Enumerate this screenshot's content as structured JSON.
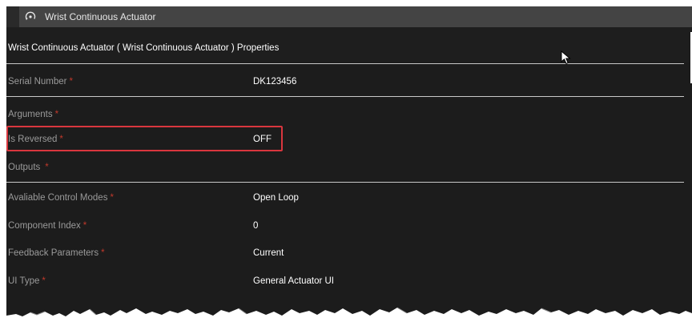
{
  "tab": {
    "icon": "rotate-actuator-icon",
    "label": "Wrist Continuous Actuator"
  },
  "properties": {
    "title": "Wrist Continuous Actuator ( Wrist Continuous Actuator ) Properties",
    "required_marker": "*",
    "rows": [
      {
        "label": "Serial Number",
        "value": "DK123456"
      },
      {
        "label": "Arguments",
        "value": ""
      },
      {
        "label": "Is Reversed",
        "value": "OFF"
      },
      {
        "label": "Outputs",
        "value": ""
      },
      {
        "label": "Avaliable Control Modes",
        "value": "Open Loop"
      },
      {
        "label": "Component Index",
        "value": "0"
      },
      {
        "label": "Feedback Parameters",
        "value": "Current"
      },
      {
        "label": "UI Type",
        "value": "General Actuator UI"
      }
    ]
  },
  "colors": {
    "panel_bg": "#1c1c1c",
    "tab_bg": "#444444",
    "label_text": "#9a9a9a",
    "value_text": "#ffffff",
    "required": "#c0392b",
    "highlight_border": "#d9363e"
  }
}
